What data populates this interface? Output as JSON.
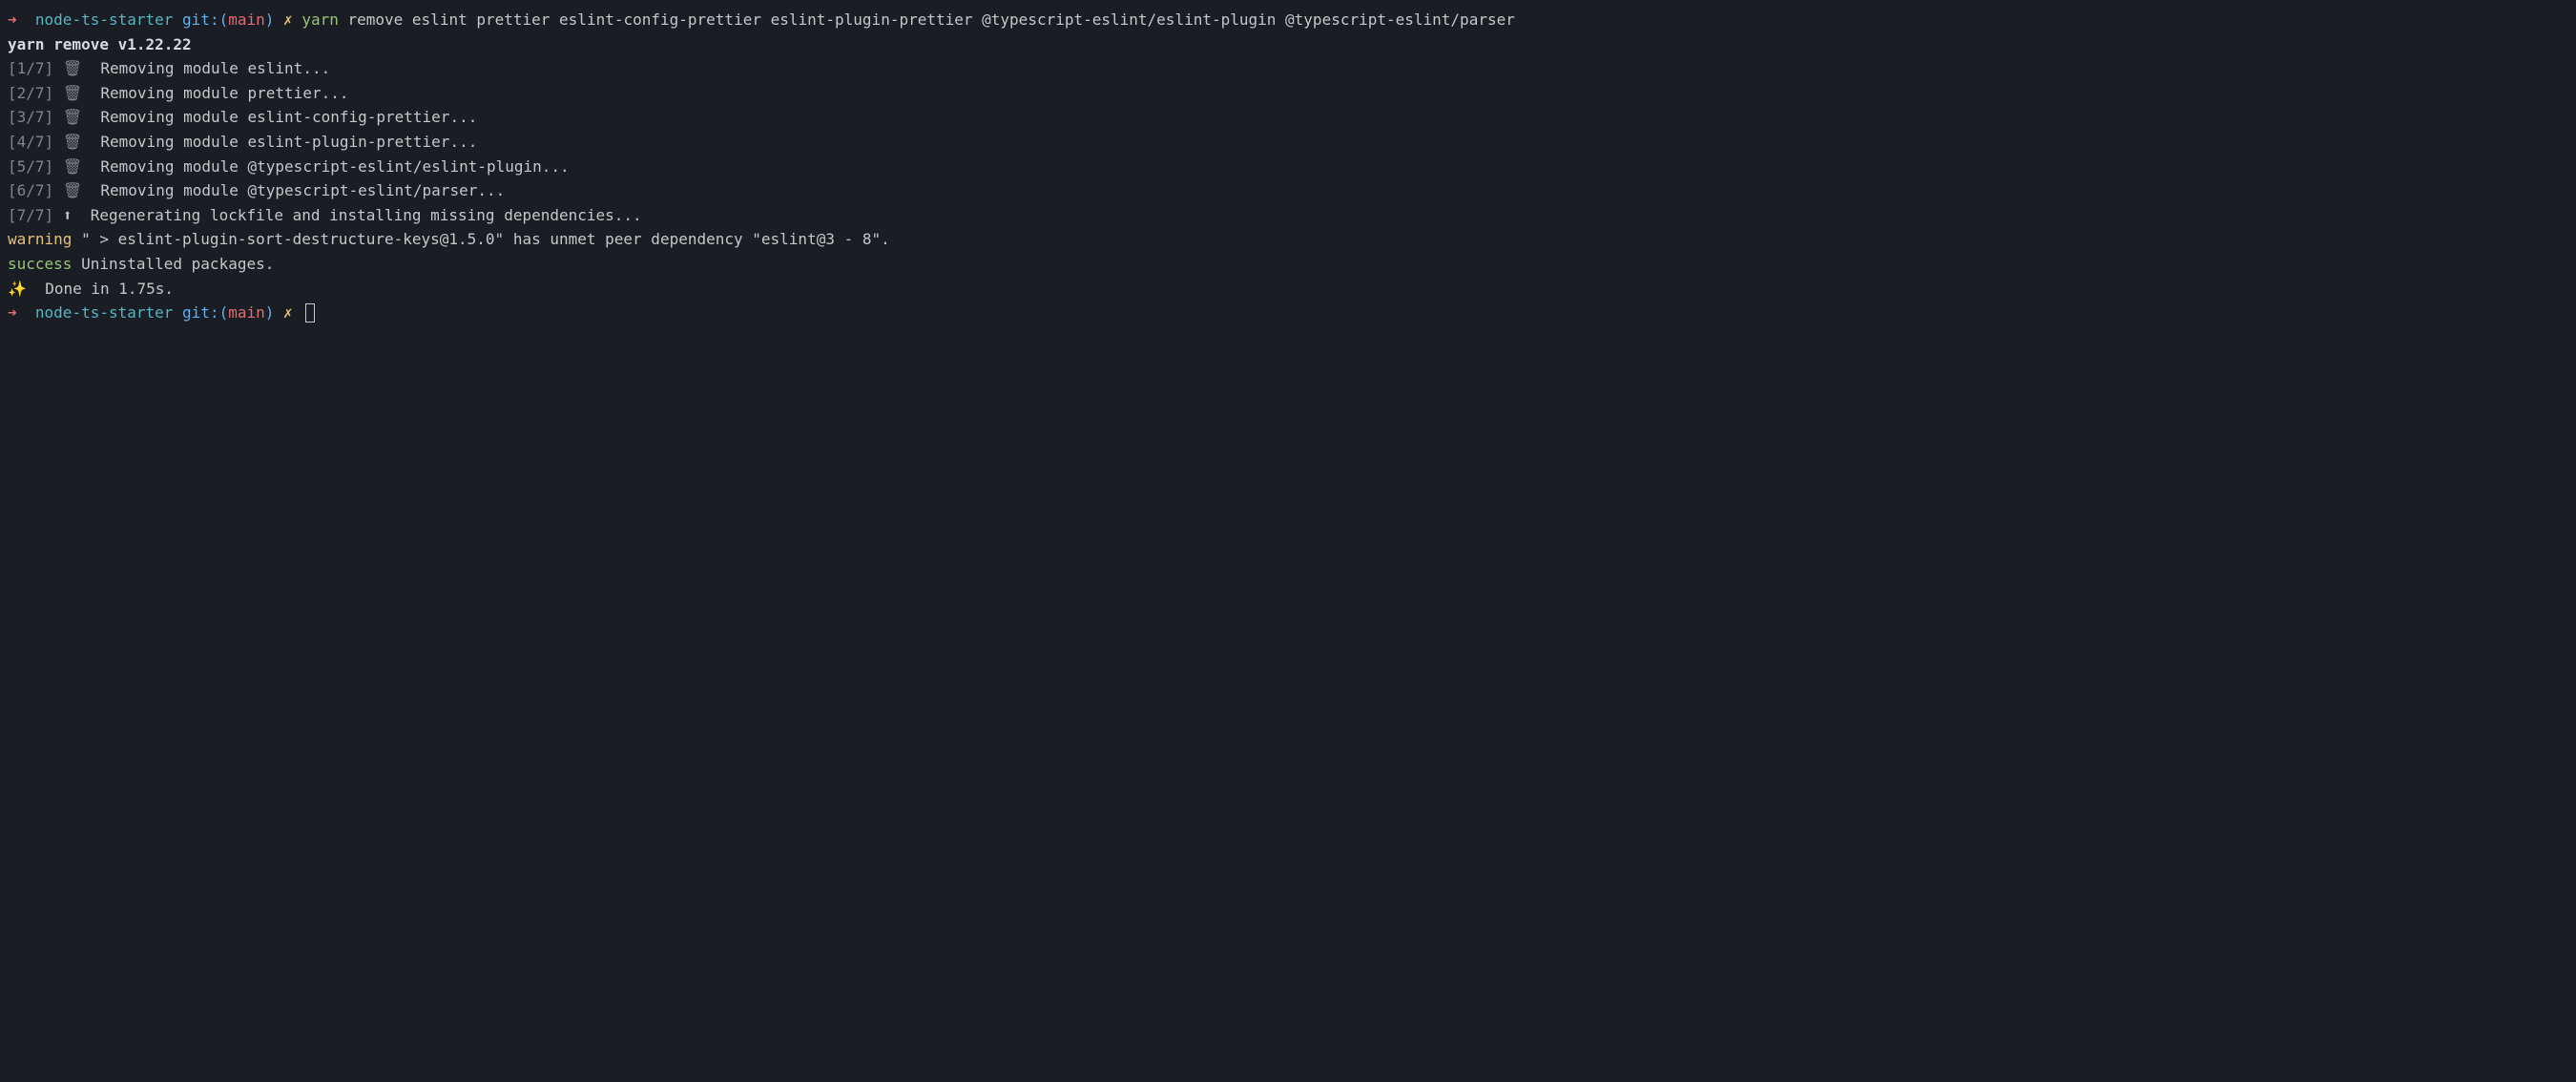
{
  "prompt1": {
    "arrow": "➜",
    "dir": "node-ts-starter",
    "git_label": "git:",
    "paren_open": "(",
    "branch": "main",
    "paren_close": ")",
    "dirty": "✗",
    "cmd_yarn": "yarn",
    "cmd_args": "remove eslint prettier eslint-config-prettier eslint-plugin-prettier @typescript-eslint/eslint-plugin @typescript-eslint/parser"
  },
  "version_line": "yarn remove v1.22.22",
  "steps": [
    {
      "counter": "[1/7]",
      "icon": "🗑",
      "text": "  Removing module eslint..."
    },
    {
      "counter": "[2/7]",
      "icon": "🗑",
      "text": "  Removing module prettier..."
    },
    {
      "counter": "[3/7]",
      "icon": "🗑",
      "text": "  Removing module eslint-config-prettier..."
    },
    {
      "counter": "[4/7]",
      "icon": "🗑",
      "text": "  Removing module eslint-plugin-prettier..."
    },
    {
      "counter": "[5/7]",
      "icon": "🗑",
      "text": "  Removing module @typescript-eslint/eslint-plugin..."
    },
    {
      "counter": "[6/7]",
      "icon": "🗑",
      "text": "  Removing module @typescript-eslint/parser..."
    },
    {
      "counter": "[7/7]",
      "icon": "⬆",
      "text": "  Regenerating lockfile and installing missing dependencies..."
    }
  ],
  "warning_label": "warning",
  "warning_text": " \" > eslint-plugin-sort-destructure-keys@1.5.0\" has unmet peer dependency \"eslint@3 - 8\".",
  "success_label": "success",
  "success_text": " Uninstalled packages.",
  "done_sparkle": "✨",
  "done_text": "  Done in 1.75s.",
  "prompt2": {
    "arrow": "➜",
    "dir": "node-ts-starter",
    "git_label": "git:",
    "paren_open": "(",
    "branch": "main",
    "paren_close": ")",
    "dirty": "✗"
  }
}
